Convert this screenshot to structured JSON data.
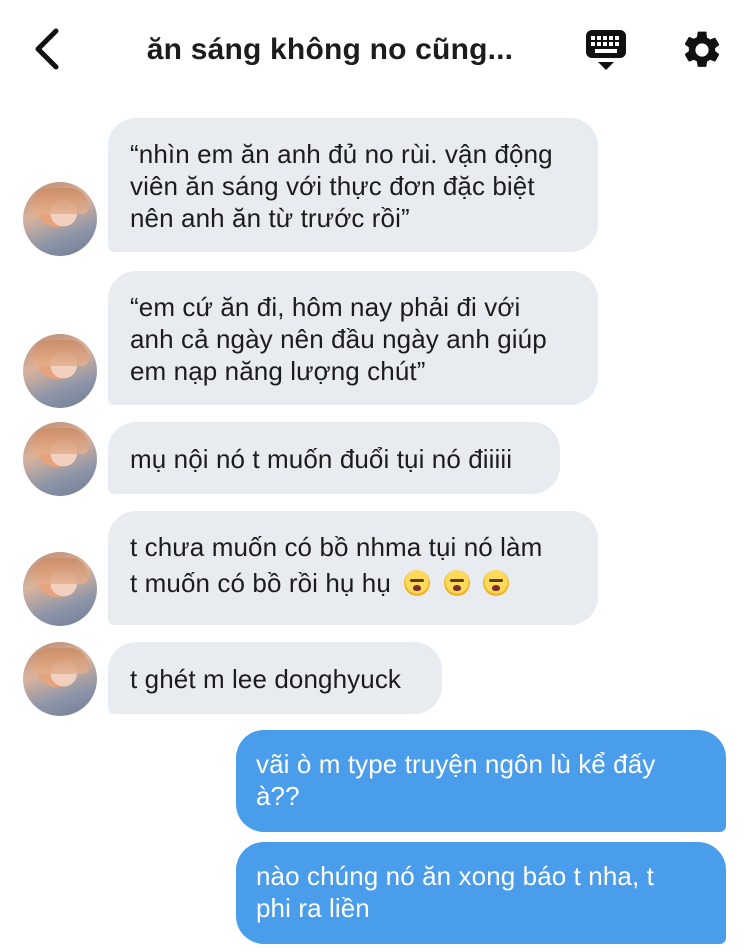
{
  "header": {
    "title": "ăn sáng không no cũng...",
    "back_icon": "chevron-left-icon",
    "keyboard_icon": "keyboard-icon",
    "settings_icon": "gear-icon"
  },
  "messages": [
    {
      "side": "in",
      "text_lines": [
        "“nhìn em ăn anh đủ no rùi. vận động",
        "viên ăn sáng với thực đơn đặc biệt",
        "nên anh ăn từ trước rồi”"
      ]
    },
    {
      "side": "in",
      "text_lines": [
        "“em cứ ăn đi, hôm nay phải đi với",
        "anh cả ngày nên đầu ngày anh giúp",
        "em nạp năng lượng chút”"
      ]
    },
    {
      "side": "in",
      "text_lines": [
        "mụ nội nó t muốn đuổi tụi nó điiiii"
      ]
    },
    {
      "side": "in",
      "text_lines": [
        "t chưa muốn có bồ nhma tụi nó làm",
        "t muốn có bồ rồi hụ hụ"
      ],
      "emojis": [
        "loudly-crying-face",
        "loudly-crying-face",
        "loudly-crying-face"
      ]
    },
    {
      "side": "in",
      "text_lines": [
        "t ghét m lee donghyuck"
      ]
    },
    {
      "side": "out",
      "text_lines": [
        "vãi ò m type truyện ngôn lù kể đấy",
        "à??"
      ]
    },
    {
      "side": "out",
      "text_lines": [
        "nào chúng nó ăn xong báo t nha, t",
        "phi ra liền"
      ]
    }
  ],
  "colors": {
    "incoming_bubble": "#e8ebf0",
    "outgoing_bubble": "#4a9dea",
    "text_dark": "#1c1c1e"
  }
}
